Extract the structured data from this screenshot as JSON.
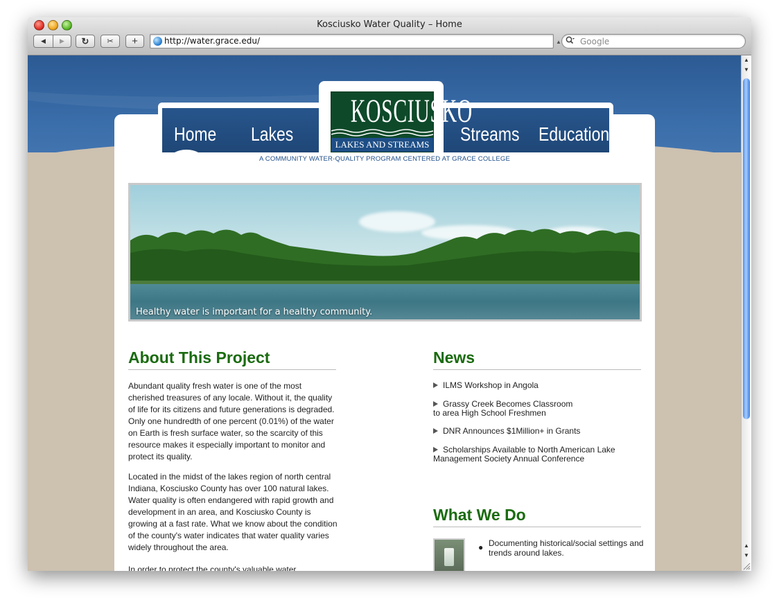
{
  "window": {
    "title": "Kosciusko Water Quality – Home"
  },
  "toolbar": {
    "back_icon": "◀",
    "forward_icon": "▶",
    "reload_icon": "↻",
    "snapshot_icon": "✂",
    "add_icon": "+",
    "url": "http://water.grace.edu/",
    "search_placeholder": "Google",
    "search_icon": "🔍"
  },
  "nav": {
    "items": [
      {
        "label": "Home"
      },
      {
        "label": "Lakes"
      },
      {
        "label": "Streams"
      },
      {
        "label": "Education"
      }
    ]
  },
  "logo": {
    "main": "KOSCIUSKO",
    "sub": "LAKES AND STREAMS",
    "tagline": "A COMMUNITY WATER-QUALITY PROGRAM CENTERED AT GRACE COLLEGE"
  },
  "hero": {
    "caption": "Healthy water is important for a healthy community."
  },
  "about": {
    "heading": "About This Project",
    "paragraphs": [
      "Abundant quality fresh water is one of the most cherished treasures of any locale.  Without it, the quality of life for its citizens and future generations is degraded.  Only one hundredth of one percent (0.01%) of the water on Earth is fresh surface water, so the scarcity of this resource makes it especially important to monitor and protect its quality.",
      "Located in the midst of the lakes region of north central Indiana, Kosciusko County has over 100 natural lakes. Water quality is often endangered with rapid growth and development in an area, and Kosciusko County is growing at a fast rate.  What we know about the condition of the county's water indicates that water quality varies widely throughout the area.",
      "In order to protect the county's valuable water"
    ]
  },
  "news": {
    "heading": "News",
    "items": [
      {
        "line1": "ILMS Workshop in Angola",
        "line2": ""
      },
      {
        "line1": "Grassy Creek Becomes Classroom",
        "line2": "to area High School Freshmen"
      },
      {
        "line1": "DNR Announces $1Million+ in Grants",
        "line2": ""
      },
      {
        "line1": "Scholarships Available to North American Lake",
        "line2": "Management Society Annual Conference"
      }
    ]
  },
  "what_we_do": {
    "heading": "What We Do",
    "items": [
      "Documenting historical/social settings and trends around lakes."
    ]
  },
  "colors": {
    "heading_green": "#1a6b0f",
    "nav_blue": "#1f4777",
    "logo_green": "#0e4a2a",
    "banner_blue": "#2c5a93",
    "background_tan": "#cdc1b0"
  }
}
